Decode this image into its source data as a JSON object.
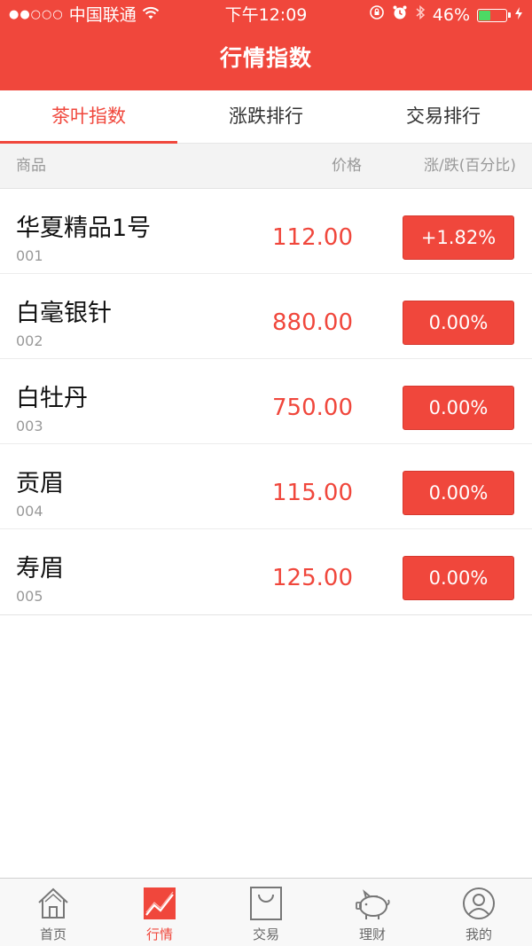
{
  "status_bar": {
    "carrier": "中国联通",
    "signal_dots": "●●○○○",
    "time": "下午12:09",
    "battery_percent": "46%",
    "battery_level": 0.46
  },
  "nav": {
    "title": "行情指数"
  },
  "tabs": [
    {
      "label": "茶叶指数",
      "active": true
    },
    {
      "label": "涨跌排行",
      "active": false
    },
    {
      "label": "交易排行",
      "active": false
    }
  ],
  "columns": {
    "product": "商品",
    "price": "价格",
    "change": "涨/跌(百分比)"
  },
  "items": [
    {
      "name": "华夏精品1号",
      "code": "001",
      "price": "112.00",
      "change": "+1.82%"
    },
    {
      "name": "白毫银针",
      "code": "002",
      "price": "880.00",
      "change": "0.00%"
    },
    {
      "name": "白牡丹",
      "code": "003",
      "price": "750.00",
      "change": "0.00%"
    },
    {
      "name": "贡眉",
      "code": "004",
      "price": "115.00",
      "change": "0.00%"
    },
    {
      "name": "寿眉",
      "code": "005",
      "price": "125.00",
      "change": "0.00%"
    }
  ],
  "tabbar": [
    {
      "label": "首页",
      "icon": "home-icon",
      "active": false
    },
    {
      "label": "行情",
      "icon": "chart-icon",
      "active": true
    },
    {
      "label": "交易",
      "icon": "shopping-bag-icon",
      "active": false
    },
    {
      "label": "理财",
      "icon": "piggy-bank-icon",
      "active": false
    },
    {
      "label": "我的",
      "icon": "user-icon",
      "active": false
    }
  ],
  "colors": {
    "brand_red": "#f0473c",
    "battery_green": "#4cd964",
    "muted_text": "#999999"
  }
}
